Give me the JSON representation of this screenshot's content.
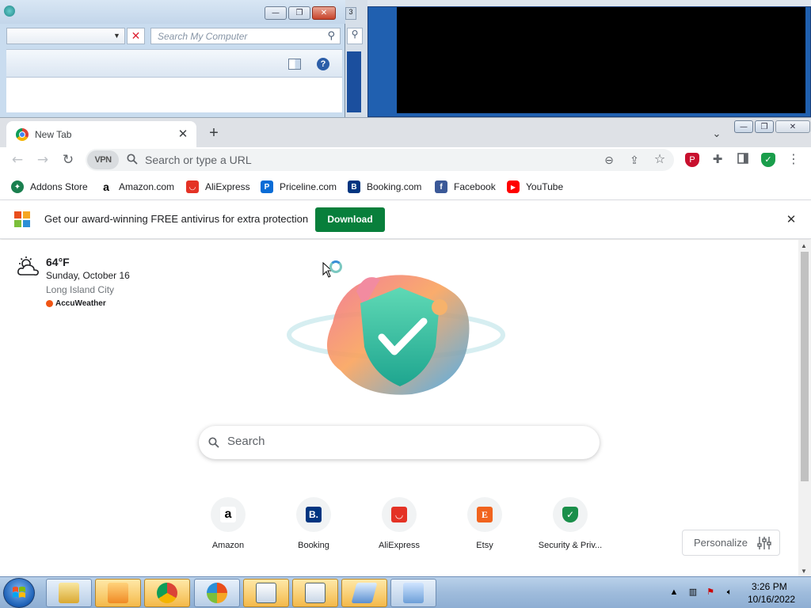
{
  "explorer": {
    "search_placeholder": "Search My Computer",
    "clear_label": "✕",
    "help_label": "?"
  },
  "chrome": {
    "tab": {
      "title": "New Tab",
      "close": "✕"
    },
    "new_tab": "+",
    "tab_search": "⌄",
    "window_buttons": {
      "minimize": "—",
      "maximize": "❐",
      "close": "✕"
    },
    "toolbar": {
      "back": "←",
      "forward": "→",
      "reload": "↻",
      "vpn": "VPN",
      "omnibox_placeholder": "Search or type a URL",
      "zoom": "⊖",
      "share": "⇪",
      "bookmark_star": "☆",
      "menu": "⋮"
    },
    "bookmarks": [
      {
        "label": "Addons Store",
        "icon": "addons-store-icon",
        "color": "#1a7f4f",
        "glyph": "✦"
      },
      {
        "label": "Amazon.com",
        "icon": "amazon-icon",
        "color": "#ffffff",
        "glyph": "a"
      },
      {
        "label": "AliExpress",
        "icon": "aliexpress-icon",
        "color": "#e43225",
        "glyph": "◡"
      },
      {
        "label": "Priceline.com",
        "icon": "priceline-icon",
        "color": "#0a6cd6",
        "glyph": "P"
      },
      {
        "label": "Booking.com",
        "icon": "booking-icon",
        "color": "#003580",
        "glyph": "B"
      },
      {
        "label": "Facebook",
        "icon": "facebook-icon",
        "color": "#3b5998",
        "glyph": "f"
      },
      {
        "label": "YouTube",
        "icon": "youtube-icon",
        "color": "#ff0000",
        "glyph": "▶"
      }
    ],
    "avbar": {
      "message": "Get our award-winning FREE antivirus for extra protection",
      "button": "Download",
      "close": "✕",
      "button_color": "#087f3b"
    },
    "weather": {
      "temp": "64°F",
      "date": "Sunday, October 16",
      "city": "Long Island City",
      "brand": "AccuWeather"
    },
    "search_placeholder": "Search",
    "tiles": [
      {
        "label": "Amazon",
        "glyph": "a",
        "color": "#000000",
        "bg": "#ffffff"
      },
      {
        "label": "Booking",
        "glyph": "B.",
        "color": "#ffffff",
        "bg": "#003580"
      },
      {
        "label": "AliExpress",
        "glyph": "◡",
        "color": "#ffffff",
        "bg": "#e43225"
      },
      {
        "label": "Etsy",
        "glyph": "E",
        "color": "#ffffff",
        "bg": "#f1641e"
      },
      {
        "label": "Security & Priv...",
        "glyph": "✓",
        "color": "#ffffff",
        "bg": "#1a8f4a"
      }
    ],
    "personalize": "Personalize"
  },
  "taskbar": {
    "time": "3:26 PM",
    "date": "10/16/2022"
  }
}
